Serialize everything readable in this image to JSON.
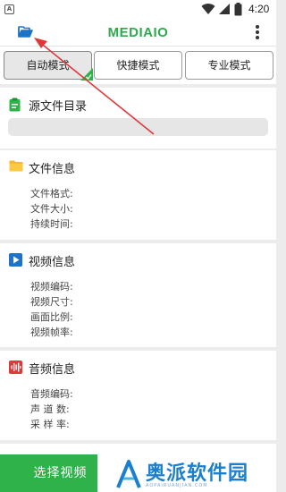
{
  "status_bar": {
    "time": "4:20",
    "notification_icon": "A"
  },
  "toolbar": {
    "title": "MEDIAIO"
  },
  "tabs": [
    {
      "label": "自动模式",
      "active": true
    },
    {
      "label": "快捷模式",
      "active": false
    },
    {
      "label": "专业模式",
      "active": false
    }
  ],
  "source": {
    "title": "源文件目录",
    "path": ""
  },
  "file_info": {
    "title": "文件信息",
    "fields": [
      "文件格式:",
      "文件大小:",
      "持续时间:"
    ]
  },
  "video_info": {
    "title": "视频信息",
    "fields": [
      "视频编码:",
      "视频尺寸:",
      "画面比例:",
      "视频帧率:"
    ]
  },
  "audio_info": {
    "title": "音频信息",
    "fields": [
      "音频编码:",
      "声 道 数:",
      "采 样 率:"
    ]
  },
  "bottom": {
    "select_video_label": "选择视频"
  },
  "watermark": {
    "text": "奥派软件园",
    "sub": "AOPAIRUANJIAN.COM"
  },
  "colors": {
    "accent": "#2fb24a",
    "title_green": "#2fa84f",
    "annotation_red": "#e0373b"
  }
}
